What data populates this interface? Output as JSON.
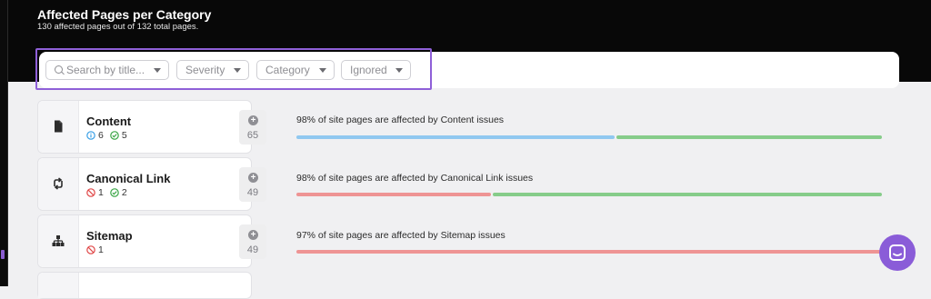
{
  "header": {
    "title": "Affected Pages per Category",
    "subtitle": "130 affected pages out of 132 total pages."
  },
  "filters": {
    "search_placeholder": "Search by title...",
    "severity_label": "Severity",
    "category_label": "Category",
    "ignored_label": "Ignored"
  },
  "categories": [
    {
      "name": "Content",
      "icon": "document-icon",
      "stats": [
        {
          "type": "info",
          "value": "6"
        },
        {
          "type": "pass",
          "value": "5"
        }
      ],
      "count": "65",
      "description": "98% of site pages are affected by Content issues",
      "bar": [
        {
          "kind": "info",
          "fraction": 0.545,
          "color": "#90c8f0"
        },
        {
          "kind": "pass",
          "fraction": 0.455,
          "color": "#86cc8a"
        }
      ]
    },
    {
      "name": "Canonical Link",
      "icon": "canonical-sync-icon",
      "stats": [
        {
          "type": "error",
          "value": "1"
        },
        {
          "type": "pass",
          "value": "2"
        }
      ],
      "count": "49",
      "description": "98% of site pages are affected by Canonical Link issues",
      "bar": [
        {
          "kind": "error",
          "fraction": 0.333,
          "color": "#ee9494"
        },
        {
          "kind": "pass",
          "fraction": 0.667,
          "color": "#86cc8a"
        }
      ]
    },
    {
      "name": "Sitemap",
      "icon": "sitemap-icon",
      "stats": [
        {
          "type": "error",
          "value": "1"
        }
      ],
      "count": "49",
      "description": "97% of site pages are affected by Sitemap issues",
      "bar": [
        {
          "kind": "error",
          "fraction": 1.0,
          "color": "#ee9494"
        }
      ]
    }
  ],
  "colors": {
    "accent": "#8f60d8",
    "info": "#3aa0e6",
    "pass": "#3aa646",
    "error": "#e04848"
  }
}
